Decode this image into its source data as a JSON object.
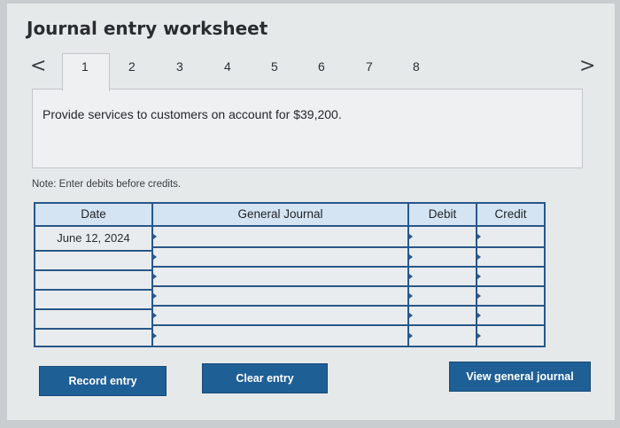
{
  "header": {
    "title": "Journal entry worksheet"
  },
  "nav": {
    "prev_glyph": "<",
    "next_glyph": ">",
    "tabs": [
      "1",
      "2",
      "3",
      "4",
      "5",
      "6",
      "7",
      "8"
    ],
    "active_tab": "1"
  },
  "question": {
    "text": "Provide services to customers on account for $39,200."
  },
  "note": "Note: Enter debits before credits.",
  "table": {
    "columns": [
      "Date",
      "General Journal",
      "Debit",
      "Credit"
    ],
    "rows": [
      {
        "date": "June 12, 2024",
        "account": "",
        "debit": "",
        "credit": ""
      },
      {
        "date": "",
        "account": "",
        "debit": "",
        "credit": ""
      },
      {
        "date": "",
        "account": "",
        "debit": "",
        "credit": ""
      },
      {
        "date": "",
        "account": "",
        "debit": "",
        "credit": ""
      },
      {
        "date": "",
        "account": "",
        "debit": "",
        "credit": ""
      },
      {
        "date": "",
        "account": "",
        "debit": "",
        "credit": ""
      }
    ]
  },
  "buttons": {
    "record": "Record entry",
    "clear": "Clear entry",
    "view": "View general journal"
  },
  "colors": {
    "accent": "#1e5f96",
    "grid": "#2a5788",
    "header_bg": "#d5e4f3"
  }
}
